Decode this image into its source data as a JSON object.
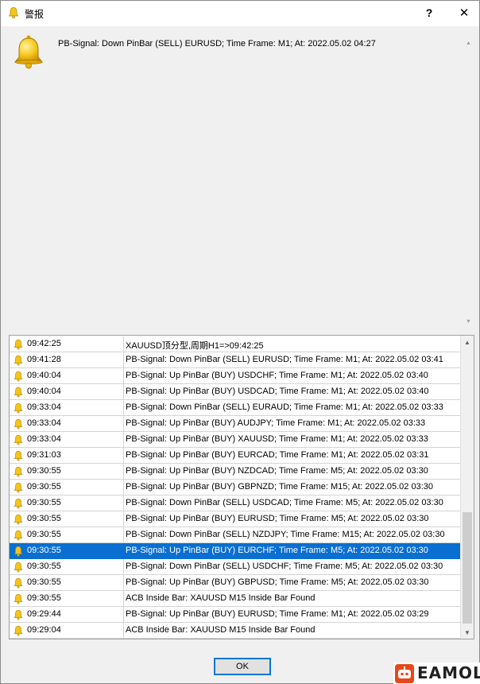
{
  "window": {
    "title": "警报",
    "help_label": "?",
    "close_label": "✕"
  },
  "message": {
    "text": "PB-Signal: Down PinBar (SELL) EURUSD; Time Frame: M1; At: 2022.05.02 04:27"
  },
  "alerts": [
    {
      "time": "09:42:25",
      "text": "XAUUSD顶分型,周期H1=>09:42:25",
      "selected": false
    },
    {
      "time": "09:41:28",
      "text": "PB-Signal: Down PinBar (SELL) EURUSD; Time Frame: M1; At: 2022.05.02 03:41",
      "selected": false
    },
    {
      "time": "09:40:04",
      "text": "PB-Signal: Up PinBar (BUY) USDCHF; Time Frame: M1; At: 2022.05.02 03:40",
      "selected": false
    },
    {
      "time": "09:40:04",
      "text": "PB-Signal: Up PinBar (BUY) USDCAD; Time Frame: M1; At: 2022.05.02 03:40",
      "selected": false
    },
    {
      "time": "09:33:04",
      "text": "PB-Signal: Down PinBar (SELL) EURAUD; Time Frame: M1; At: 2022.05.02 03:33",
      "selected": false
    },
    {
      "time": "09:33:04",
      "text": "PB-Signal: Up PinBar (BUY) AUDJPY; Time Frame: M1; At: 2022.05.02 03:33",
      "selected": false
    },
    {
      "time": "09:33:04",
      "text": "PB-Signal: Up PinBar (BUY) XAUUSD; Time Frame: M1; At: 2022.05.02 03:33",
      "selected": false
    },
    {
      "time": "09:31:03",
      "text": "PB-Signal: Up PinBar (BUY) EURCAD; Time Frame: M1; At: 2022.05.02 03:31",
      "selected": false
    },
    {
      "time": "09:30:55",
      "text": "PB-Signal: Up PinBar (BUY) NZDCAD; Time Frame: M5; At: 2022.05.02 03:30",
      "selected": false
    },
    {
      "time": "09:30:55",
      "text": "PB-Signal: Up PinBar (BUY) GBPNZD; Time Frame: M15; At: 2022.05.02 03:30",
      "selected": false
    },
    {
      "time": "09:30:55",
      "text": "PB-Signal: Down PinBar (SELL) USDCAD; Time Frame: M5; At: 2022.05.02 03:30",
      "selected": false
    },
    {
      "time": "09:30:55",
      "text": "PB-Signal: Up PinBar (BUY) EURUSD; Time Frame: M5; At: 2022.05.02 03:30",
      "selected": false
    },
    {
      "time": "09:30:55",
      "text": "PB-Signal: Down PinBar (SELL) NZDJPY; Time Frame: M15; At: 2022.05.02 03:30",
      "selected": false
    },
    {
      "time": "09:30:55",
      "text": "PB-Signal: Up PinBar (BUY) EURCHF; Time Frame: M5; At: 2022.05.02 03:30",
      "selected": true
    },
    {
      "time": "09:30:55",
      "text": "PB-Signal: Down PinBar (SELL) USDCHF; Time Frame: M5; At: 2022.05.02 03:30",
      "selected": false
    },
    {
      "time": "09:30:55",
      "text": "PB-Signal: Up PinBar (BUY) GBPUSD; Time Frame: M5; At: 2022.05.02 03:30",
      "selected": false
    },
    {
      "time": "09:30:55",
      "text": "ACB Inside Bar: XAUUSD M15 Inside Bar Found",
      "selected": false
    },
    {
      "time": "09:29:44",
      "text": "PB-Signal: Up PinBar (BUY) EURUSD; Time Frame: M1; At: 2022.05.02 03:29",
      "selected": false
    },
    {
      "time": "09:29:04",
      "text": "ACB Inside Bar: XAUUSD M15 Inside Bar Found",
      "selected": false
    }
  ],
  "buttons": {
    "ok_label": "OK"
  },
  "watermark": {
    "text": "EAMOL"
  },
  "icons": {
    "bell": "bell-icon",
    "badge": "robot-icon"
  },
  "colors": {
    "selection": "#0a6fd1",
    "bell_fill": "#f5c518",
    "bell_stroke": "#b8860b"
  }
}
